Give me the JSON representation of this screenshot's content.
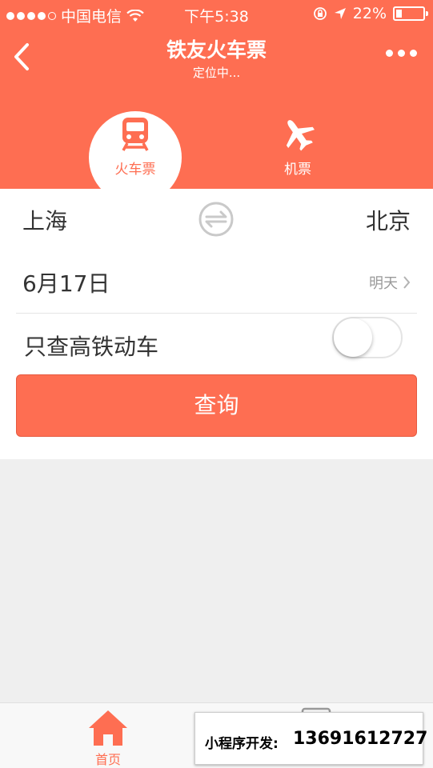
{
  "status_bar": {
    "carrier": "中国电信",
    "time": "下午5:38",
    "battery": "22%",
    "battery_level": 0.22
  },
  "nav": {
    "title": "铁友火车票",
    "subtitle": "定位中..."
  },
  "tabs": [
    {
      "label": "火车票",
      "icon": "train-icon",
      "active": true
    },
    {
      "label": "机票",
      "icon": "plane-icon",
      "active": false
    }
  ],
  "search": {
    "from": "上海",
    "to": "北京",
    "date": "6月17日",
    "date_hint": "明天",
    "high_speed_label": "只查高铁动车",
    "high_speed_on": false,
    "query_label": "查询"
  },
  "tabbar": {
    "home_label": "首页"
  },
  "watermark": {
    "label": "小程序开发:",
    "phone": "13691612727"
  },
  "colors": {
    "brand": "#fe6e52",
    "background": "#efefef"
  }
}
